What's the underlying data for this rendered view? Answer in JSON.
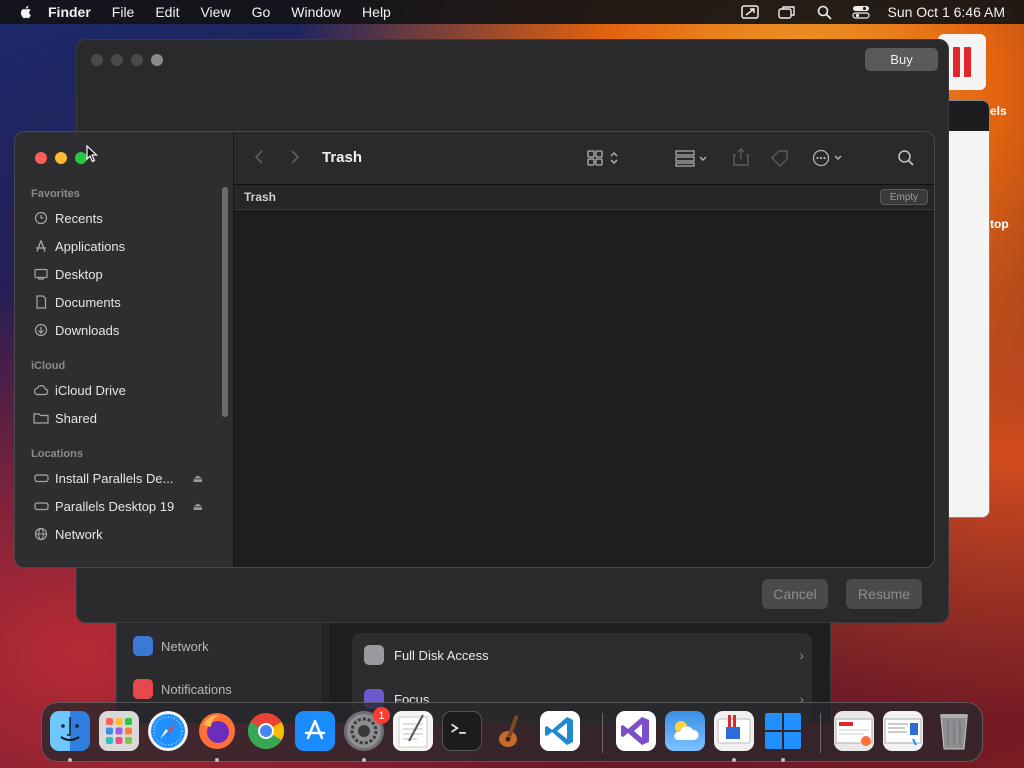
{
  "menubar": {
    "app_name": "Finder",
    "items": [
      "File",
      "Edit",
      "View",
      "Go",
      "Window",
      "Help"
    ],
    "clock": "Sun Oct 1  6:46 AM",
    "status_icons": [
      "screen-mirroring-icon",
      "window-switcher-icon",
      "spotlight-icon",
      "control-center-icon"
    ]
  },
  "parallels": {
    "buy_label": "Buy",
    "cancel_label": "Cancel",
    "resume_label": "Resume",
    "side_text_1": "els",
    "side_text_2": "top"
  },
  "settings": {
    "sidebar": [
      {
        "label": "Network",
        "color": "#3b79d6"
      },
      {
        "label": "Notifications",
        "color": "#e5484d"
      }
    ],
    "rows": [
      {
        "label": "Full Disk Access",
        "color": "#9a9aa0"
      },
      {
        "label": "Focus",
        "color": "#6a5acd"
      }
    ]
  },
  "finder": {
    "title": "Trash",
    "path_label": "Trash",
    "empty_label": "Empty",
    "sections": {
      "favorites": {
        "heading": "Favorites",
        "items": [
          {
            "label": "Recents",
            "icon": "clock-icon"
          },
          {
            "label": "Applications",
            "icon": "applications-icon"
          },
          {
            "label": "Desktop",
            "icon": "desktop-icon"
          },
          {
            "label": "Documents",
            "icon": "document-icon"
          },
          {
            "label": "Downloads",
            "icon": "download-icon"
          }
        ]
      },
      "icloud": {
        "heading": "iCloud",
        "items": [
          {
            "label": "iCloud Drive",
            "icon": "cloud-icon"
          },
          {
            "label": "Shared",
            "icon": "shared-folder-icon"
          }
        ]
      },
      "locations": {
        "heading": "Locations",
        "items": [
          {
            "label": "Install Parallels De...",
            "icon": "disk-icon",
            "eject": true
          },
          {
            "label": "Parallels Desktop 19",
            "icon": "disk-icon",
            "eject": true
          },
          {
            "label": "Network",
            "icon": "network-icon",
            "eject": false
          }
        ]
      }
    }
  },
  "dock": {
    "badge_count": "1",
    "apps": [
      {
        "name": "Finder",
        "color": "#3a8ee6",
        "running": true
      },
      {
        "name": "Launchpad",
        "color": "#d9d9d9",
        "running": false
      },
      {
        "name": "Safari",
        "color": "#1e90ff",
        "running": false
      },
      {
        "name": "Firefox",
        "color": "#ff7139",
        "running": true
      },
      {
        "name": "Chrome",
        "color": "#ffffff",
        "running": false
      },
      {
        "name": "App Store",
        "color": "#1a8cff",
        "running": false
      },
      {
        "name": "System Settings",
        "color": "#8e8e93",
        "running": true
      },
      {
        "name": "TextEdit",
        "color": "#f5f5f0",
        "running": false
      },
      {
        "name": "Terminal",
        "color": "#1c1c1c",
        "running": false
      },
      {
        "name": "GarageBand",
        "color": "#c86a2a",
        "running": false
      },
      {
        "name": "Visual Studio Code",
        "color": "#ffffff",
        "running": false
      },
      {
        "name": "Visual Studio",
        "color": "#ffffff",
        "running": false
      },
      {
        "name": "Weather",
        "color": "#3a8ee6",
        "running": false
      },
      {
        "name": "Parallels Desktop",
        "color": "#f0f0f0",
        "running": true
      },
      {
        "name": "Windows",
        "color": "#1c1c1c",
        "running": true
      },
      {
        "name": "Recent Document 1",
        "color": "#e8e8e8",
        "running": false
      },
      {
        "name": "Recent Document 2",
        "color": "#f2f2f2",
        "running": false
      },
      {
        "name": "Trash",
        "color": "#8e8e93",
        "running": false
      }
    ]
  }
}
